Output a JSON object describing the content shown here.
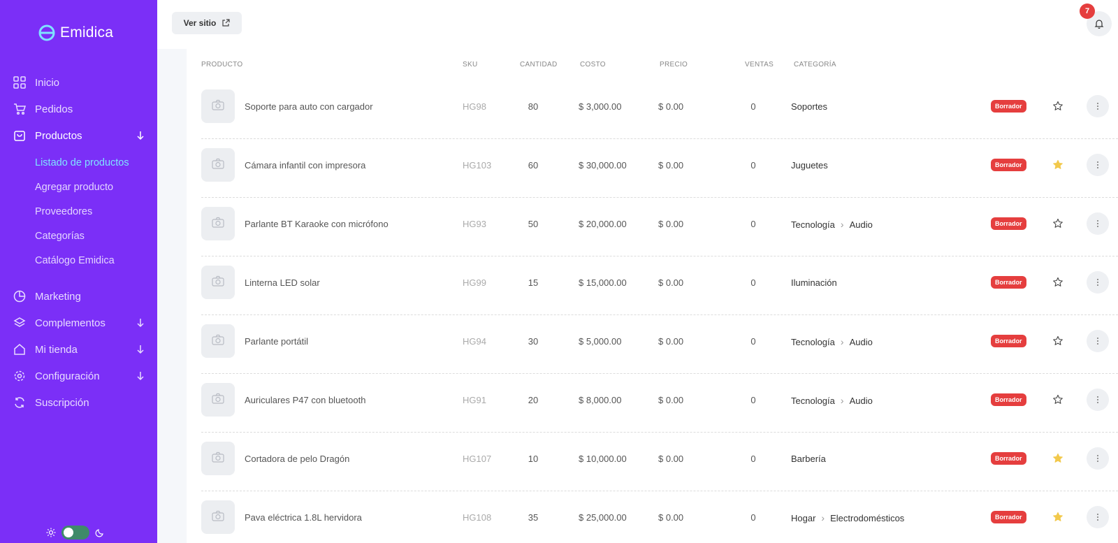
{
  "brand": {
    "name": "Emidica"
  },
  "sidebar": {
    "items": [
      {
        "label": "Inicio",
        "icon": "grid-icon"
      },
      {
        "label": "Pedidos",
        "icon": "cart-icon"
      },
      {
        "label": "Productos",
        "icon": "bag-icon",
        "expanded": true
      },
      {
        "label": "Marketing",
        "icon": "pie-chart-icon"
      },
      {
        "label": "Complementos",
        "icon": "layers-icon"
      },
      {
        "label": "Mi tienda",
        "icon": "home-icon"
      },
      {
        "label": "Configuración",
        "icon": "gear-icon"
      },
      {
        "label": "Suscripción",
        "icon": "refresh-icon"
      }
    ],
    "subitems": [
      {
        "label": "Listado de productos",
        "current": true
      },
      {
        "label": "Agregar producto"
      },
      {
        "label": "Proveedores"
      },
      {
        "label": "Categorías"
      },
      {
        "label": "Catálogo Emidica"
      }
    ],
    "theme_toggle": {
      "mode": "light"
    }
  },
  "topbar": {
    "ver_sitio": "Ver sitio",
    "notifications_count": "7"
  },
  "colors": {
    "sidebar_bg": "#7b2ff7",
    "active_link": "#7fe3ff",
    "badge_red": "#e53e3e",
    "star_gold": "#f2c94c"
  },
  "table": {
    "headers": {
      "producto": "PRODUCTO",
      "sku": "SKU",
      "cantidad": "CANTIDAD",
      "costo": "COSTO",
      "precio": "PRECIO",
      "ventas": "VENTAS",
      "categoria": "CATEGORÍA"
    },
    "rows": [
      {
        "name": "Soporte para auto con cargador",
        "sku": "HG98",
        "qty": "80",
        "cost": "$ 3,000.00",
        "price": "$ 0.00",
        "sales": "0",
        "cat": [
          "Soportes"
        ],
        "status": "Borrador",
        "starred": false
      },
      {
        "name": "Cámara infantil con impresora",
        "sku": "HG103",
        "qty": "60",
        "cost": "$ 30,000.00",
        "price": "$ 0.00",
        "sales": "0",
        "cat": [
          "Juguetes"
        ],
        "status": "Borrador",
        "starred": true
      },
      {
        "name": "Parlante BT Karaoke con micrófono",
        "sku": "HG93",
        "qty": "50",
        "cost": "$ 20,000.00",
        "price": "$ 0.00",
        "sales": "0",
        "cat": [
          "Tecnología",
          "Audio"
        ],
        "status": "Borrador",
        "starred": false
      },
      {
        "name": "Linterna LED solar",
        "sku": "HG99",
        "qty": "15",
        "cost": "$ 15,000.00",
        "price": "$ 0.00",
        "sales": "0",
        "cat": [
          "Iluminación"
        ],
        "status": "Borrador",
        "starred": false
      },
      {
        "name": "Parlante portátil",
        "sku": "HG94",
        "qty": "30",
        "cost": "$ 5,000.00",
        "price": "$ 0.00",
        "sales": "0",
        "cat": [
          "Tecnología",
          "Audio"
        ],
        "status": "Borrador",
        "starred": false
      },
      {
        "name": "Auriculares P47 con bluetooth",
        "sku": "HG91",
        "qty": "20",
        "cost": "$ 8,000.00",
        "price": "$ 0.00",
        "sales": "0",
        "cat": [
          "Tecnología",
          "Audio"
        ],
        "status": "Borrador",
        "starred": false
      },
      {
        "name": "Cortadora de pelo Dragón",
        "sku": "HG107",
        "qty": "10",
        "cost": "$ 10,000.00",
        "price": "$ 0.00",
        "sales": "0",
        "cat": [
          "Barbería"
        ],
        "status": "Borrador",
        "starred": true
      },
      {
        "name": "Pava eléctrica 1.8L hervidora",
        "sku": "HG108",
        "qty": "35",
        "cost": "$ 25,000.00",
        "price": "$ 0.00",
        "sales": "0",
        "cat": [
          "Hogar",
          "Electrodomésticos"
        ],
        "status": "Borrador",
        "starred": true
      }
    ]
  }
}
